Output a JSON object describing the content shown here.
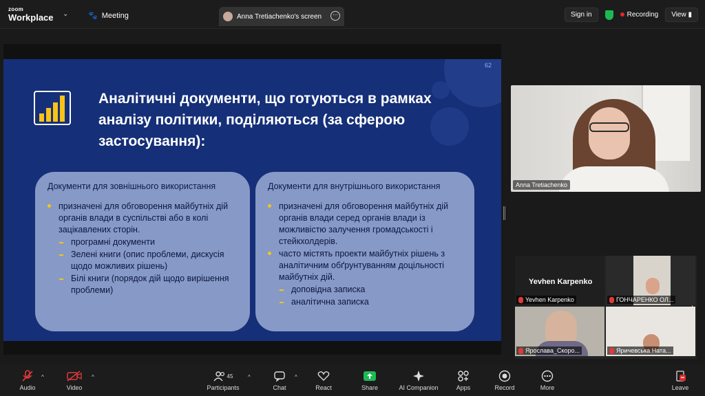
{
  "topbar": {
    "brand_small": "zoom",
    "brand_big": "Workplace",
    "meeting_label": "Meeting",
    "share_tab_label": "Anna Tretiachenko's screen",
    "signin_label": "Sign in",
    "recording_label": "Recording",
    "view_label": "View"
  },
  "slide": {
    "page_number": "62",
    "title": "Аналітичні документи, що готуються в рамках аналізу політики, поділяються (за сферою застосування):",
    "left_card": {
      "heading": "Документи для зовнішнього використання",
      "items": [
        {
          "kind": "dot",
          "text": "призначені для обговорення майбутніх дій органів влади в суспільстві або в колі зацікавлених сторін."
        },
        {
          "kind": "dash",
          "text": "програмні документи"
        },
        {
          "kind": "dash",
          "text": "Зелені книги (опис проблеми, дискусія щодо можливих рішень)"
        },
        {
          "kind": "dash",
          "text": "Білі книги (порядок дій щодо вирішення проблеми)"
        }
      ]
    },
    "right_card": {
      "heading": "Документи для внутрішнього використання",
      "items": [
        {
          "kind": "dot",
          "text": "призначені для обговорення майбутніх дій органів влади серед органів влади із можливістю залучення громадськості і стейкхолдерів."
        },
        {
          "kind": "dot",
          "text": "часто містять проекти майбутніх рішень з аналітичним обґрунтуванням доцільності майбутніх дій."
        },
        {
          "kind": "dash",
          "text": "доповідна записка"
        },
        {
          "kind": "dash",
          "text": "аналітична записка"
        }
      ]
    }
  },
  "speaker": {
    "name": "Anna Tretiachenko"
  },
  "gallery": {
    "tiles": [
      {
        "name": "Yevhen Karpenko",
        "display": "Yevhen Karpenko"
      },
      {
        "name": "ГОНЧАРЕНКО ОЛ..."
      },
      {
        "name": "Ярослава_Скоро..."
      },
      {
        "name": "Яричевська Ната..."
      }
    ]
  },
  "toolbar": {
    "audio": "Audio",
    "video": "Video",
    "participants": "Participants",
    "participants_count": "45",
    "chat": "Chat",
    "react": "React",
    "share": "Share",
    "ai_companion": "AI Companion",
    "apps": "Apps",
    "record": "Record",
    "more": "More",
    "leave": "Leave"
  },
  "colors": {
    "slide_bg": "#152f78",
    "card_bg": "#8799c6",
    "accent_yellow": "#f5c518",
    "share_green": "#1db954",
    "record_red": "#e02828"
  }
}
